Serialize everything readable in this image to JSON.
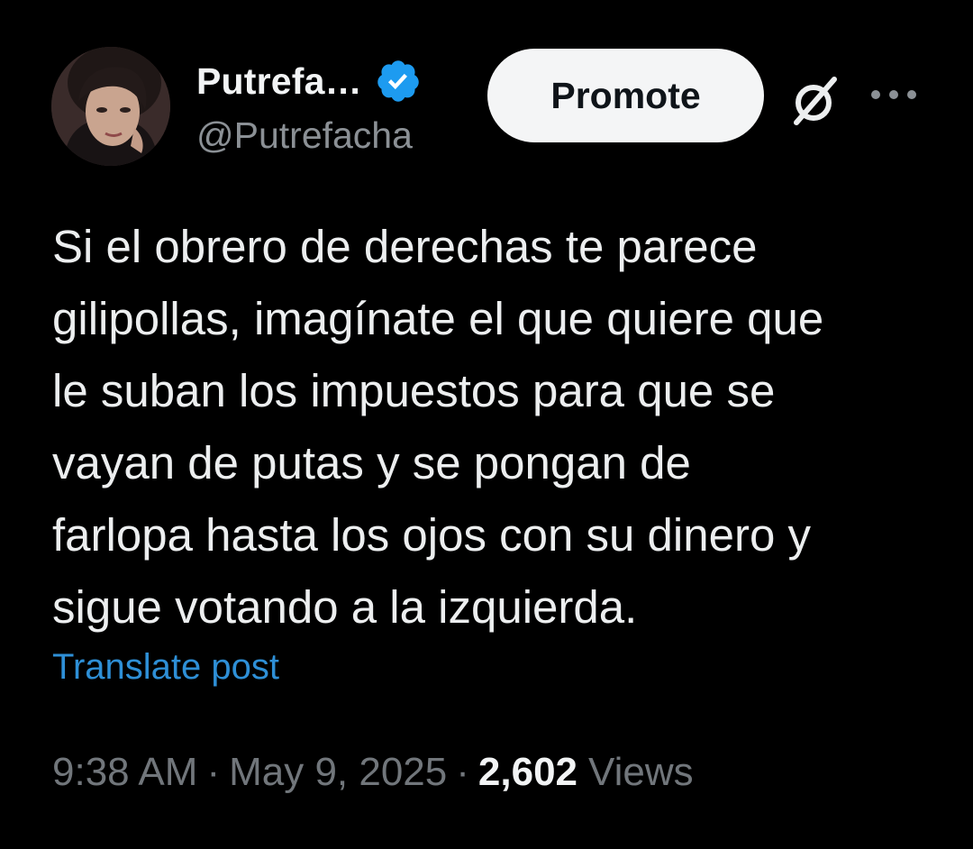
{
  "author": {
    "display_name": "Putrefa…",
    "handle": "@Putrefacha",
    "verified": true
  },
  "header": {
    "promote_label": "Promote",
    "grok_icon": "grok-slash-icon",
    "more_icon": "more-dots-icon"
  },
  "tweet": {
    "text": "Si el obrero de derechas te parece\ngilipollas, imagínate el que quiere que\nle suban los impuestos para que se\nvayan de putas y se pongan de\nfarlopa hasta los ojos con su dinero y\nsigue votando a la izquierda.",
    "translate_label": "Translate post"
  },
  "meta": {
    "time": "9:38 AM",
    "separator": "·",
    "date": "May 9, 2025",
    "views_count": "2,602",
    "views_label": "Views"
  },
  "colors": {
    "background": "#000000",
    "link": "#2e8fd6",
    "verified": "#1d9bf0",
    "muted": "#71767b"
  }
}
